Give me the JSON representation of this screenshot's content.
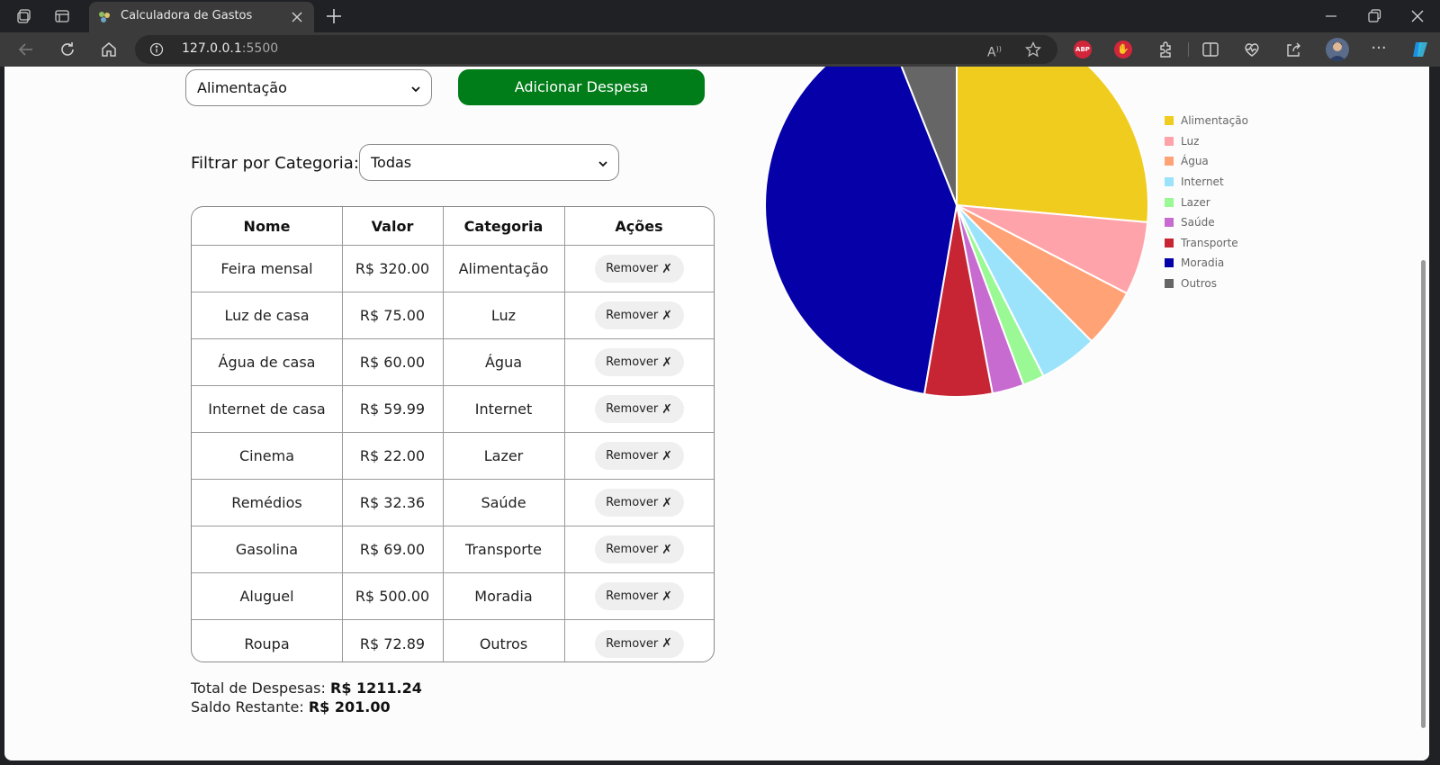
{
  "browser": {
    "tab_title": "Calculadora de Gastos",
    "url_host": "127.0.0.1",
    "url_port": ":5500"
  },
  "form": {
    "category_select_value": "Alimentação",
    "add_button_label": "Adicionar Despesa"
  },
  "filter": {
    "label": "Filtrar por Categoria:",
    "select_value": "Todas"
  },
  "table": {
    "headers": [
      "Nome",
      "Valor",
      "Categoria",
      "Ações"
    ],
    "remove_label": "Remover",
    "remove_glyph": "✗",
    "rows": [
      {
        "nome": "Feira mensal",
        "valor": "R$ 320.00",
        "categoria": "Alimentação"
      },
      {
        "nome": "Luz de casa",
        "valor": "R$ 75.00",
        "categoria": "Luz"
      },
      {
        "nome": "Água de casa",
        "valor": "R$ 60.00",
        "categoria": "Água"
      },
      {
        "nome": "Internet de casa",
        "valor": "R$ 59.99",
        "categoria": "Internet"
      },
      {
        "nome": "Cinema",
        "valor": "R$ 22.00",
        "categoria": "Lazer"
      },
      {
        "nome": "Remédios",
        "valor": "R$ 32.36",
        "categoria": "Saúde"
      },
      {
        "nome": "Gasolina",
        "valor": "R$ 69.00",
        "categoria": "Transporte"
      },
      {
        "nome": "Aluguel",
        "valor": "R$ 500.00",
        "categoria": "Moradia"
      },
      {
        "nome": "Roupa",
        "valor": "R$ 72.89",
        "categoria": "Outros"
      }
    ]
  },
  "totals": {
    "total_label": "Total de Despesas:",
    "total_value": "R$ 1211.24",
    "saldo_label": "Saldo Restante:",
    "saldo_value": "R$ 201.00"
  },
  "chart_data": {
    "type": "pie",
    "categories": [
      "Alimentação",
      "Luz",
      "Água",
      "Internet",
      "Lazer",
      "Saúde",
      "Transporte",
      "Moradia",
      "Outros"
    ],
    "values": [
      320.0,
      75.0,
      60.0,
      59.99,
      22.0,
      32.36,
      69.0,
      500.0,
      72.89
    ],
    "colors": [
      "#f0cc1f",
      "#ffa3aa",
      "#ffa276",
      "#9be3fb",
      "#9bf995",
      "#c76bd1",
      "#c72533",
      "#0500a8",
      "#666666"
    ],
    "legend_position": "right"
  }
}
